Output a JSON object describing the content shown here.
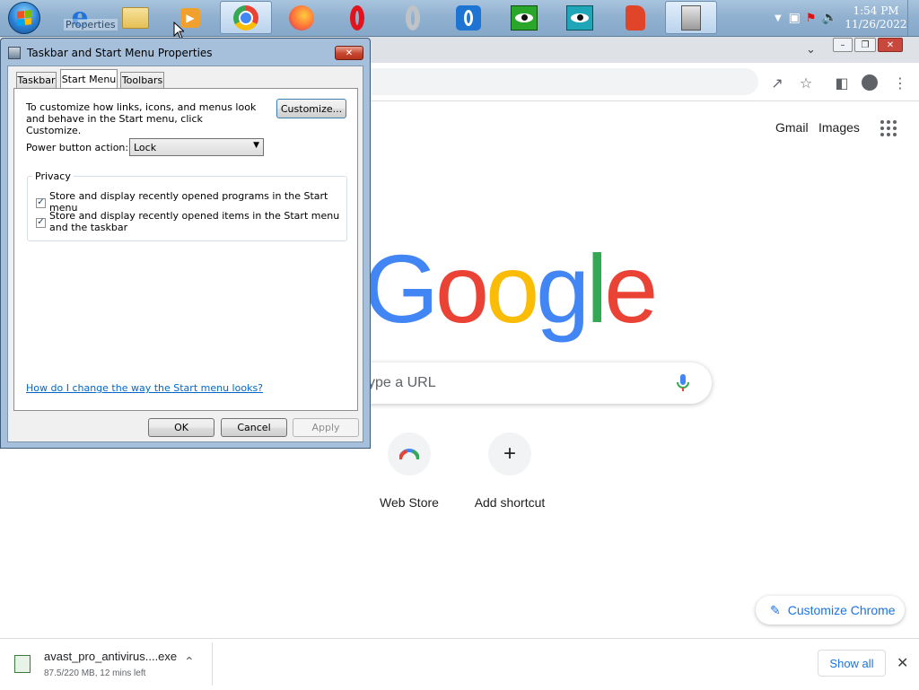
{
  "taskbar": {
    "hover_tooltip": "Properties",
    "apps": [
      {
        "name": "internet-explorer-icon"
      },
      {
        "name": "folder-icon"
      },
      {
        "name": "media-player-icon"
      },
      {
        "name": "chrome-icon"
      },
      {
        "name": "firefox-icon"
      },
      {
        "name": "opera-icon"
      },
      {
        "name": "opera-gray-icon"
      },
      {
        "name": "opera-blue-icon"
      },
      {
        "name": "eye-green-icon"
      },
      {
        "name": "eye-teal-icon"
      },
      {
        "name": "face-app-icon"
      },
      {
        "name": "server-app-icon"
      }
    ],
    "time": "1:54 PM",
    "date": "11/26/2022"
  },
  "dialog": {
    "title": "Taskbar and Start Menu Properties",
    "tabs": [
      {
        "label": "Taskbar"
      },
      {
        "label": "Start Menu"
      },
      {
        "label": "Toolbars"
      }
    ],
    "description": "To customize how links, icons, and menus look and behave in the Start menu, click Customize.",
    "customize_label": "Customize...",
    "power_label": "Power button action:",
    "power_value": "Lock",
    "privacy_group": "Privacy",
    "checkbox1_label": "Store and display recently opened programs in the Start menu",
    "checkbox2_label": "Store and display recently opened items in the Start menu and the taskbar",
    "help_link": "How do I change the way the Start menu looks?",
    "ok_label": "OK",
    "cancel_label": "Cancel",
    "apply_label": "Apply"
  },
  "chrome": {
    "gmail": "Gmail",
    "images": "Images",
    "logo_letters": [
      "G",
      "o",
      "o",
      "g",
      "l",
      "e"
    ],
    "logo_colors": [
      "#4285f4",
      "#ea4335",
      "#fbbc05",
      "#4285f4",
      "#34a853",
      "#ea4335"
    ],
    "search_placeholder": "ype a URL",
    "shortcuts": [
      {
        "label": "Web Store"
      },
      {
        "label": "Add shortcut"
      }
    ],
    "customize_chrome": "Customize Chrome"
  },
  "download": {
    "filename": "avast_pro_antivirus....exe",
    "status": "87.5/220 MB, 12 mins left",
    "show_all": "Show all"
  }
}
